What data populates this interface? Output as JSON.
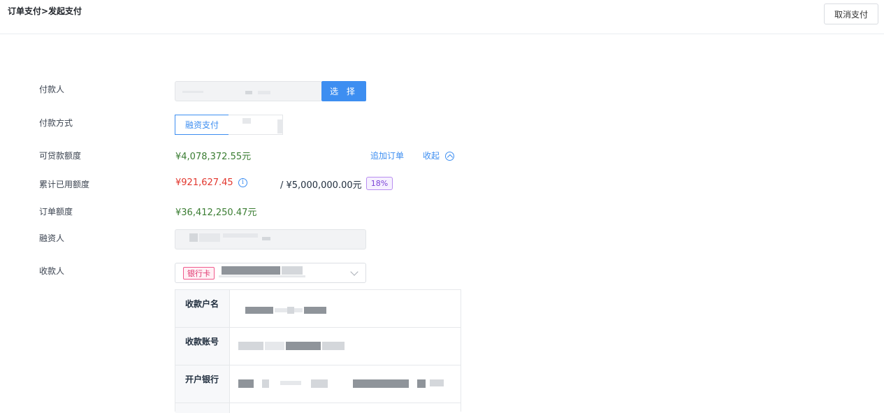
{
  "header": {
    "breadcrumb": "订单支付>发起支付",
    "cancel_label": "取消支付"
  },
  "form": {
    "payer_label": "付款人",
    "select_label": "选 择",
    "pay_method_label": "付款方式",
    "pay_method_option": "融资支付",
    "loanable_label": "可贷款额度",
    "loanable_amount": "¥4,078,372.55元",
    "add_order_label": "追加订单",
    "collapse_label": "收起",
    "used_label": "累计已用额度",
    "used_amount": "¥921,627.45",
    "total_limit": "/ ¥5,000,000.00元",
    "used_percent": "18%",
    "order_amount_label": "订单额度",
    "order_amount": "¥36,412,250.47元",
    "financier_label": "融资人",
    "payee_label": "收款人",
    "bank_tag": "银行卡"
  },
  "payee_details": {
    "rows": [
      {
        "head": "收款户名"
      },
      {
        "head": "收款账号"
      },
      {
        "head": "开户银行"
      }
    ]
  },
  "colors": {
    "primary": "#3d8ef1",
    "amount_green": "#3a7d32",
    "amount_red": "#e2372e",
    "badge_purple": "#7b43d6",
    "tag_pink": "#e03870"
  }
}
